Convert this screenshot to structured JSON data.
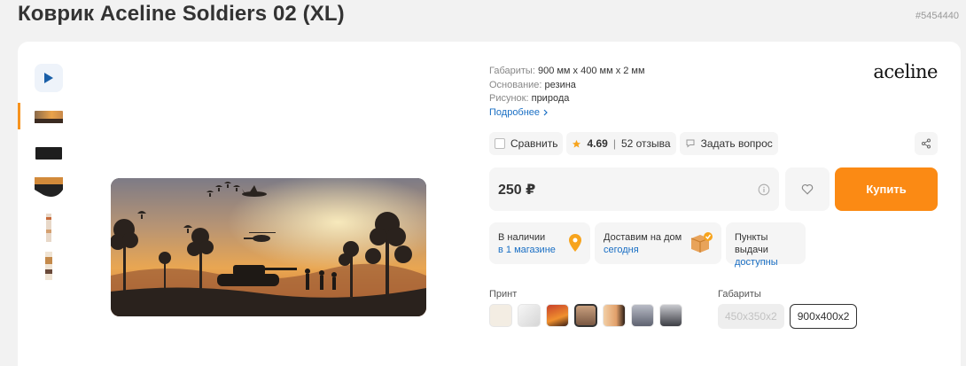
{
  "product": {
    "title": "Коврик Aceline Soldiers 02 (XL)",
    "code": "#5454440",
    "brand": "aceline"
  },
  "specs": [
    {
      "label": "Габариты:",
      "value": "900 мм x 400 мм x 2 мм"
    },
    {
      "label": "Основание:",
      "value": "резина"
    },
    {
      "label": "Рисунок:",
      "value": "природа"
    }
  ],
  "more_label": "Подробнее",
  "actions": {
    "compare": "Сравнить",
    "rating": "4.69",
    "separator": "|",
    "reviews": "52 отзыва",
    "ask": "Задать вопрос"
  },
  "price": "250 ₽",
  "buy_label": "Купить",
  "availability": [
    {
      "line1": "В наличии",
      "line2": "в 1 магазине"
    },
    {
      "line1": "Доставим на дом",
      "line2": "сегодня"
    },
    {
      "line1": "Пункты выдачи",
      "line2": "доступны"
    }
  ],
  "print_label": "Принт",
  "size_label": "Габариты",
  "sizes": [
    "450x350x2",
    "900x400x2"
  ],
  "colors": {
    "accent": "#fb8a14",
    "link": "#1a6fc4",
    "star": "#f7a41d"
  }
}
